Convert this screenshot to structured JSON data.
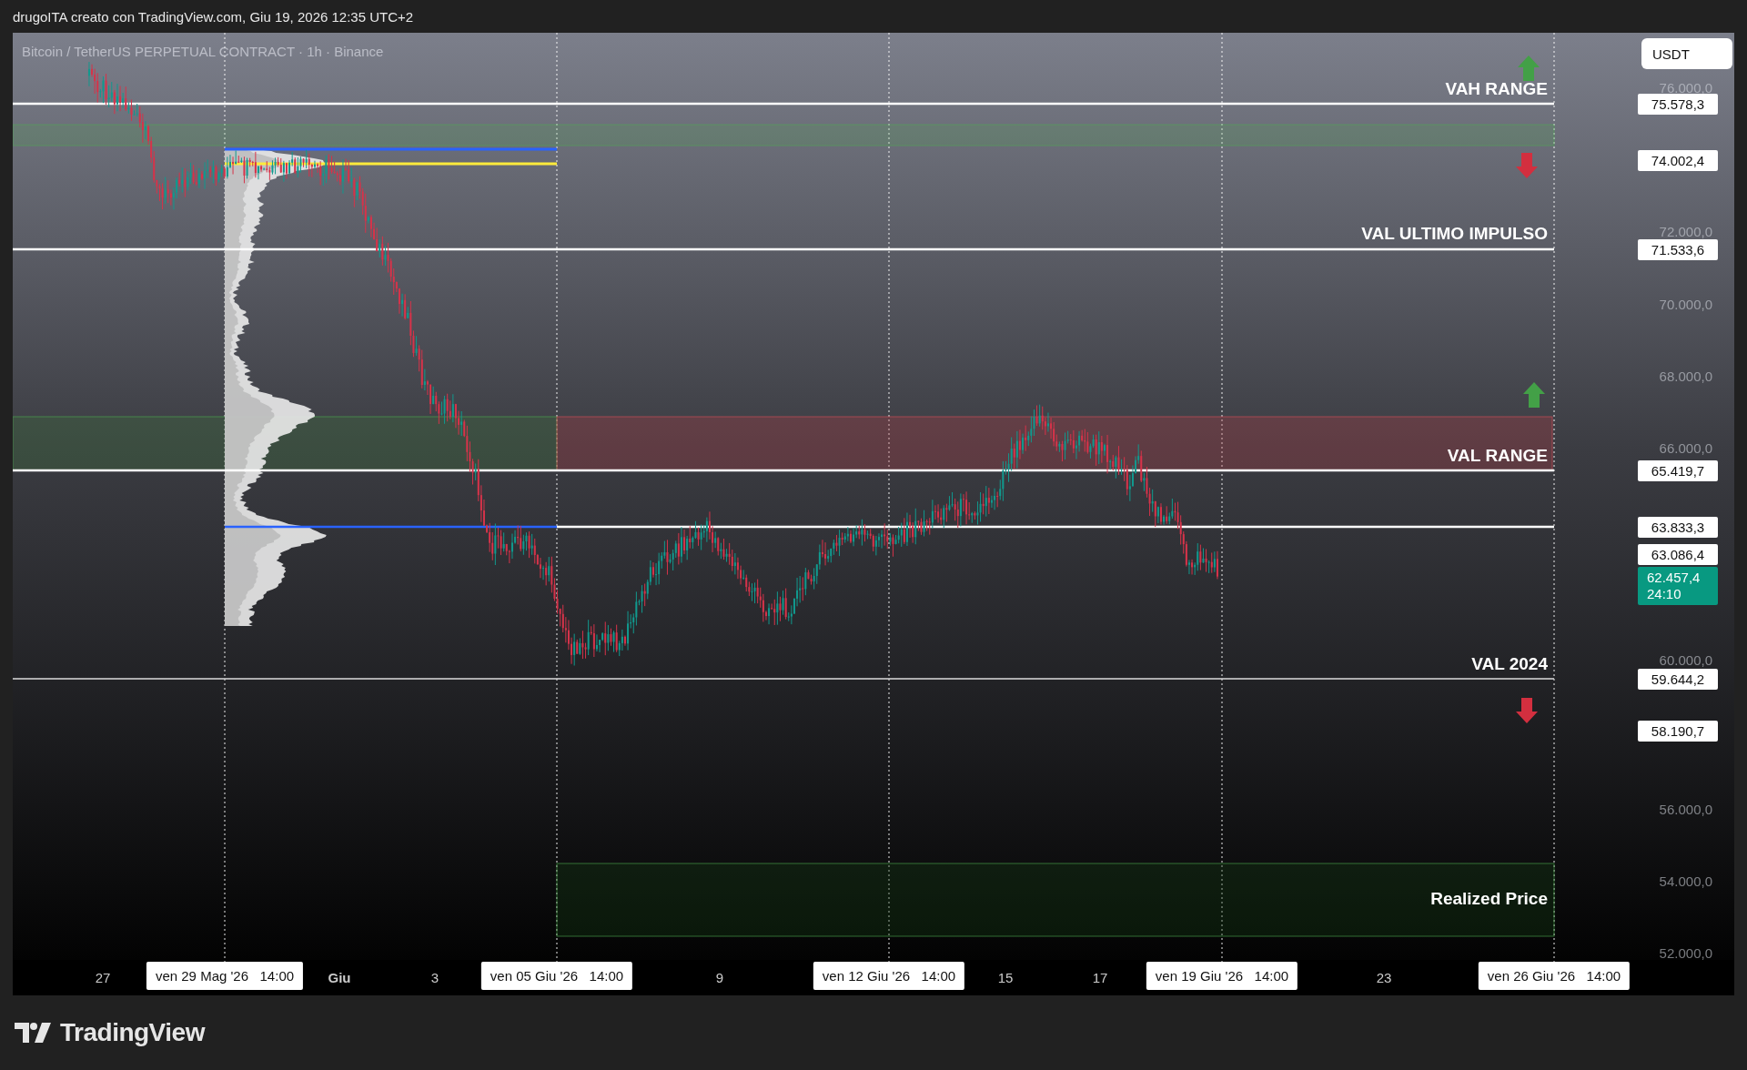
{
  "header": {
    "text": "drugoITA creato con TradingView.com, Giu 19, 2026 12:35 UTC+2"
  },
  "chart": {
    "symbol_title": "Bitcoin / TetherUS PERPETUAL CONTRACT · 1h · Binance",
    "currency": "USDT",
    "price_ticks": [
      "76.000,0",
      "72.000,0",
      "70.000,0",
      "68.000,0",
      "66.000,0",
      "60.000,0",
      "56.000,0",
      "54.000,0",
      "52.000,0"
    ],
    "price_labels": [
      {
        "text": "75.578,3",
        "kind": "line"
      },
      {
        "text": "74.002,4",
        "kind": "line"
      },
      {
        "text": "71.533,6",
        "kind": "line"
      },
      {
        "text": "65.419,7",
        "kind": "line"
      },
      {
        "text": "63.833,3",
        "kind": "line"
      },
      {
        "text": "63.086,4",
        "kind": "line"
      },
      {
        "text": "62.457,4",
        "kind": "last",
        "countdown": "24:10"
      },
      {
        "text": "59.644,2",
        "kind": "line"
      },
      {
        "text": "58.190,7",
        "kind": "line"
      }
    ],
    "level_labels": [
      "VAH RANGE",
      "VAL ULTIMO IMPULSO",
      "VAL RANGE",
      "VAL 2024",
      "Realized Price"
    ],
    "time_labels": [
      {
        "text": "27",
        "kind": "tick"
      },
      {
        "text": "ven 29 Mag '26   14:00",
        "kind": "marker"
      },
      {
        "text": "Giu",
        "kind": "month"
      },
      {
        "text": "3",
        "kind": "tick"
      },
      {
        "text": "ven 05 Giu '26   14:00",
        "kind": "marker"
      },
      {
        "text": "9",
        "kind": "tick"
      },
      {
        "text": "ven 12 Giu '26   14:00",
        "kind": "marker"
      },
      {
        "text": "15",
        "kind": "tick"
      },
      {
        "text": "17",
        "kind": "tick"
      },
      {
        "text": "ven 19 Giu '26   14:00",
        "kind": "marker"
      },
      {
        "text": "23",
        "kind": "tick"
      },
      {
        "text": "ven 26 Giu '26   14:00",
        "kind": "marker"
      }
    ]
  },
  "footer": {
    "logo": "TradingView"
  }
}
